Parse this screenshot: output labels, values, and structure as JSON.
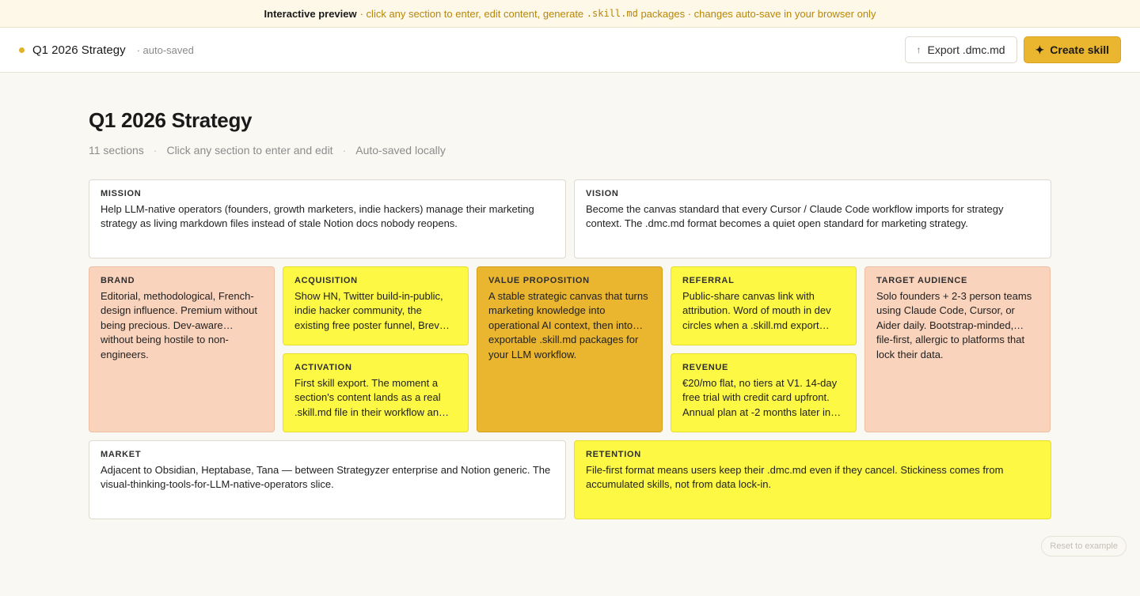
{
  "banner": {
    "strong": "Interactive preview",
    "text_before": "· click any section to enter, edit content, generate",
    "code": ".skill.md",
    "text_after": "packages · changes auto-save in your browser only"
  },
  "topbar": {
    "doc_title": "Q1 2026 Strategy",
    "saved_status": "· auto-saved",
    "export_label": "Export .dmc.md",
    "create_label": "Create skill"
  },
  "page": {
    "title": "Q1 2026 Strategy",
    "meta": [
      "11 sections",
      "Click any section to enter and edit",
      "Auto-saved locally"
    ]
  },
  "sections": {
    "mission": {
      "label": "MISSION",
      "text": "Help LLM-native operators (founders, growth marketers, indie hackers) manage their marketing strategy as living markdown files instead of stale Notion docs nobody reopens."
    },
    "vision": {
      "label": "VISION",
      "text": "Become the canvas standard that every Cursor / Claude Code workflow imports for strategy context. The .dmc.md format becomes a quiet open standard for marketing strategy."
    },
    "brand": {
      "label": "BRAND",
      "text": "Editorial, methodological, French-design influence. Premium without being precious. Dev-aware… without being hostile to non-engineers."
    },
    "acquisition": {
      "label": "ACQUISITION",
      "text": "Show HN, Twitter build-in-public, indie hacker community, the existing free poster funnel, Brev…"
    },
    "activation": {
      "label": "ACTIVATION",
      "text": "First skill export. The moment a section's content lands as a real .skill.md file in their workflow an…"
    },
    "value_proposition": {
      "label": "VALUE PROPOSITION",
      "text": "A stable strategic canvas that turns marketing knowledge into operational AI context, then into… exportable .skill.md packages for your LLM workflow."
    },
    "referral": {
      "label": "REFERRAL",
      "text": "Public-share canvas link with attribution. Word of mouth in dev circles when a .skill.md export…"
    },
    "revenue": {
      "label": "REVENUE",
      "text": "€20/mo flat, no tiers at V1. 14-day free trial with credit card upfront. Annual plan at -2 months later in…"
    },
    "target_audience": {
      "label": "TARGET AUDIENCE",
      "text": "Solo founders + 2-3 person teams using Claude Code, Cursor, or Aider daily. Bootstrap-minded,… file-first, allergic to platforms that lock their data."
    },
    "market": {
      "label": "MARKET",
      "text": "Adjacent to Obsidian, Heptabase, Tana — between Strategyzer enterprise and Notion generic. The visual-thinking-tools-for-LLM-native-operators slice."
    },
    "retention": {
      "label": "RETENTION",
      "text": "File-first format means users keep their .dmc.md even if they cancel. Stickiness comes from accumulated skills, not from data lock-in."
    }
  },
  "footer": {
    "reset_label": "Reset to example"
  },
  "colors": {
    "accent": "#ebb62f",
    "peach": "#fad3bd",
    "yellow": "#fdf844",
    "gold": "#ebb62f"
  }
}
